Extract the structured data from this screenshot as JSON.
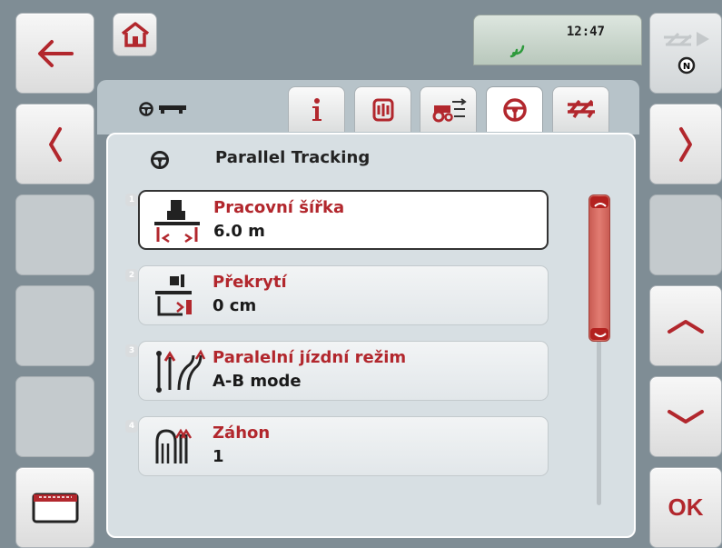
{
  "status": {
    "time": "12:47"
  },
  "page": {
    "title": "Parallel Tracking"
  },
  "tabs": [
    "info-icon",
    "implement-icon",
    "tractor-settings-icon",
    "steering-wheel-icon",
    "sprayer-icon"
  ],
  "active_tab": 3,
  "rows": [
    {
      "num": "1",
      "label": "Pracovní šířka",
      "value": "6.0 m",
      "icon": "working-width-icon"
    },
    {
      "num": "2",
      "label": "Překrytí",
      "value": "0 cm",
      "icon": "overlap-icon"
    },
    {
      "num": "3",
      "label": "Paralelní jízdní režim",
      "value": "A-B mode",
      "icon": "parallel-mode-icon"
    },
    {
      "num": "4",
      "label": "Záhon",
      "value": "1",
      "icon": "bed-icon"
    }
  ],
  "buttons": {
    "ok": "OK"
  },
  "colors": {
    "accent": "#b2272d",
    "scroll": "#d96c62",
    "background": "#7f8d95"
  }
}
